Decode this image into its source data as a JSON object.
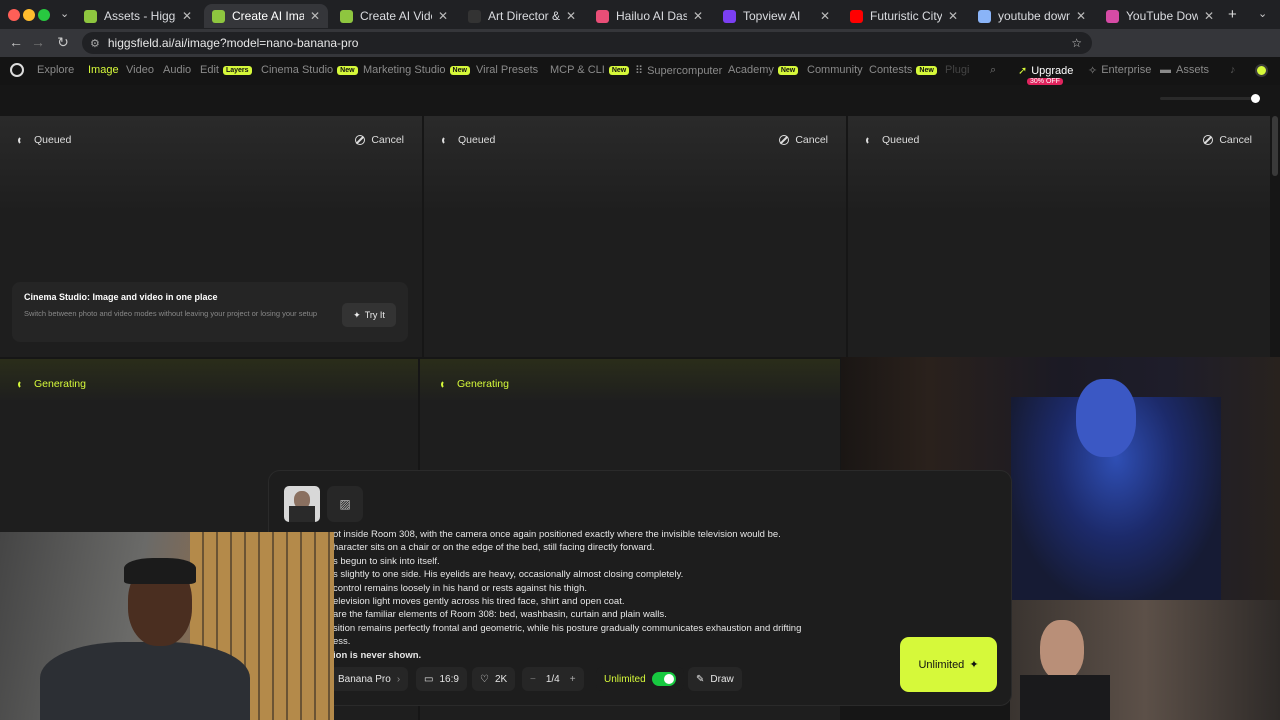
{
  "browser": {
    "tabs": [
      {
        "title": "Assets - Higgsfield",
        "color": "#8ec63f"
      },
      {
        "title": "Create AI Images fro",
        "color": "#8ec63f"
      },
      {
        "title": "Create AI Videos fro",
        "color": "#8ec63f"
      },
      {
        "title": "Art Director & AI Cre",
        "color": "#333333"
      },
      {
        "title": "Hailuo AI Dashboard",
        "color": "#e94e77"
      },
      {
        "title": "Topview AI",
        "color": "#7b3ff2"
      },
      {
        "title": "Futuristic City Ambie",
        "color": "#ff0000"
      },
      {
        "title": "youtube download o",
        "color": "#8ab4f8"
      },
      {
        "title": "YouTube Downloader",
        "color": "#d64ba5"
      }
    ],
    "url": "higgsfield.ai/ai/image?model=nano-banana-pro"
  },
  "nav": {
    "items": [
      {
        "label": "Explore",
        "badge": ""
      },
      {
        "label": "Image",
        "badge": ""
      },
      {
        "label": "Video",
        "badge": ""
      },
      {
        "label": "Audio",
        "badge": ""
      },
      {
        "label": "Edit",
        "badge": "Layers"
      },
      {
        "label": "Cinema Studio",
        "badge": "New"
      },
      {
        "label": "Marketing Studio",
        "badge": "New"
      },
      {
        "label": "Viral Presets",
        "badge": ""
      },
      {
        "label": "MCP & CLI",
        "badge": "New"
      },
      {
        "label": "Supercomputer",
        "badge": ""
      },
      {
        "label": "Academy",
        "badge": "New"
      },
      {
        "label": "Community",
        "badge": ""
      },
      {
        "label": "Contests",
        "badge": "New"
      },
      {
        "label": "Plugi",
        "badge": ""
      }
    ],
    "upgrade": "Upgrade",
    "upgrade_off": "30% OFF",
    "enterprise": "Enterprise",
    "assets": "Assets"
  },
  "cards": {
    "queued_label": "Queued",
    "cancel_label": "Cancel",
    "generating_label": "Generating"
  },
  "promo": {
    "title": "Cinema Studio: Image and video in one place",
    "desc": "Switch between photo and video modes without leaving your project or losing your setup",
    "button": "Try It"
  },
  "prompt": {
    "lines": [
      "ot inside Room 308, with the camera once again positioned exactly where the invisible television would be.",
      "haracter sits on a chair or on the edge of the bed, still facing directly forward.",
      "s begun to sink into itself.",
      "s slightly to one side. His eyelids are heavy, occasionally almost closing completely.",
      "control remains loosely in his hand or rests against his thigh.",
      "elevision light moves gently across his tired face, shirt and open coat.",
      "are the familiar elements of Room 308: bed, washbasin, curtain and plain walls.",
      "sition remains perfectly frontal and geometric, while his posture gradually communicates exhaustion and drifting",
      "ess.",
      "ion is never shown."
    ]
  },
  "controls": {
    "model": "Banana Pro",
    "aspect": "16:9",
    "quality": "2K",
    "count": "1/4",
    "unlimited": "Unlimited",
    "draw": "Draw",
    "generate": "Unlimited"
  }
}
